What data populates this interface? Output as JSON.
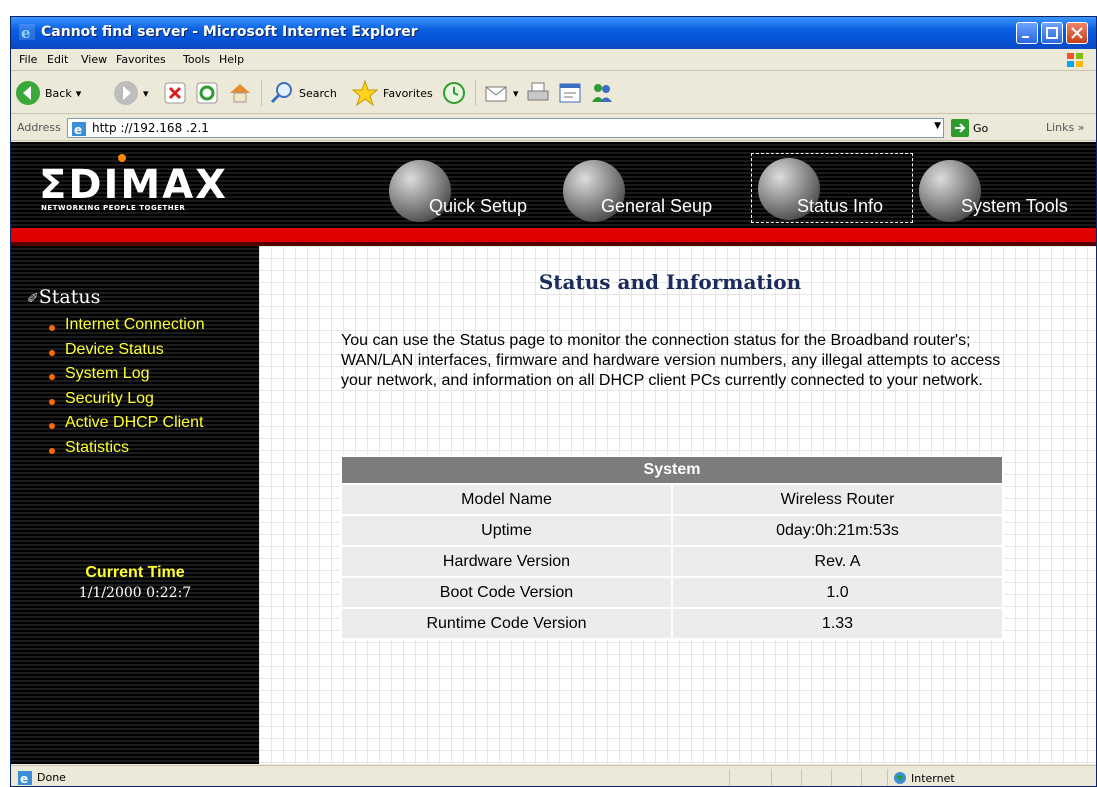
{
  "window": {
    "title": "Cannot find server - Microsoft Internet Explorer"
  },
  "menu": {
    "items": [
      "File",
      "Edit",
      "View",
      "Favorites",
      "Tools",
      "Help"
    ]
  },
  "toolbar": {
    "back_label": "Back",
    "search_label": "Search",
    "favorites_label": "Favorites"
  },
  "address": {
    "label": "Address",
    "url": "http ://192.168 .2.1",
    "go_label": "Go",
    "links_label": "Links"
  },
  "header": {
    "logo": "ΣDIMAX",
    "tagline": "NETWORKING PEOPLE TOGETHER",
    "nav": [
      "Quick Setup",
      "General Seup",
      "Status Info",
      "System Tools"
    ]
  },
  "sidebar": {
    "title": "Status",
    "links": [
      "Internet Connection",
      "Device Status",
      "System Log",
      "Security Log",
      "Active DHCP Client",
      "Statistics"
    ],
    "time_title": "Current Time",
    "time_value": "1/1/2000 0:22:7"
  },
  "main": {
    "title": "Status and Information",
    "description": "You can use the Status page to monitor the connection status for the Broadband router's; WAN/LAN interfaces, firmware and hardware version numbers, any illegal attempts to access your network, and information on all DHCP client PCs currently connected to your network.",
    "table": {
      "header": "System",
      "rows": [
        {
          "label": "Model Name",
          "value": "Wireless Router"
        },
        {
          "label": "Uptime",
          "value": "0day:0h:21m:53s"
        },
        {
          "label": "Hardware Version",
          "value": "Rev. A"
        },
        {
          "label": "Boot Code Version",
          "value": "1.0"
        },
        {
          "label": "Runtime Code Version",
          "value": "1.33"
        }
      ]
    }
  },
  "statusbar": {
    "text": "Done",
    "zone": "Internet"
  }
}
